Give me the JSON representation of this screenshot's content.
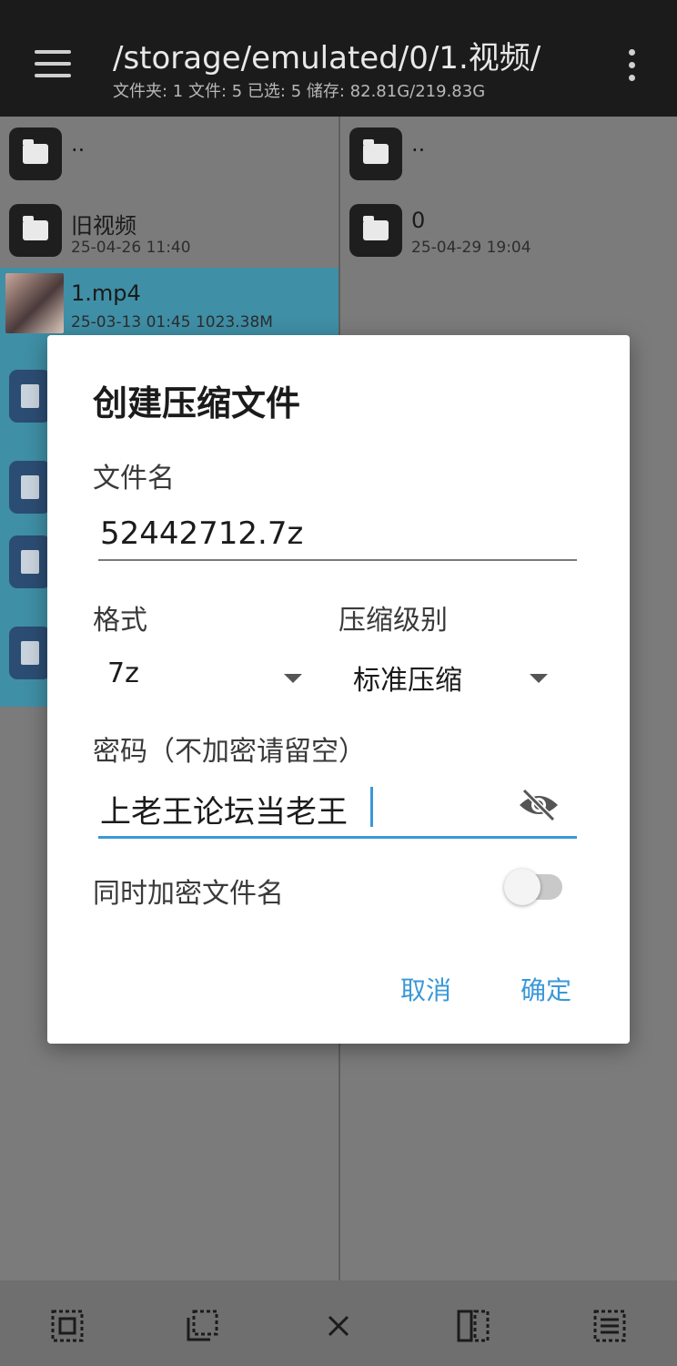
{
  "header": {
    "path": "/storage/emulated/0/1.视频/",
    "stats": "文件夹: 1  文件: 5  已选: 5  储存: 82.81G/219.83G"
  },
  "left_pane": {
    "items": [
      {
        "name": "..",
        "meta": ""
      },
      {
        "name": "旧视频",
        "meta": "25-04-26 11:40"
      },
      {
        "name": "1.mp4",
        "meta": "25-03-13 01:45  1023.38M"
      }
    ]
  },
  "right_pane": {
    "items": [
      {
        "name": "..",
        "meta": ""
      },
      {
        "name": "0",
        "meta": "25-04-29 19:04"
      }
    ]
  },
  "dialog": {
    "title": "创建压缩文件",
    "filename_label": "文件名",
    "filename_value": "52442712.7z",
    "format_label": "格式",
    "format_value": "7z",
    "level_label": "压缩级别",
    "level_value": "标准压缩",
    "password_label": "密码（不加密请留空）",
    "password_value": "上老王论坛当老王",
    "encrypt_names_label": "同时加密文件名",
    "encrypt_names_on": false,
    "cancel_label": "取消",
    "ok_label": "确定"
  },
  "colors": {
    "accent": "#3a98d8",
    "selected_row": "#3f8fa6"
  }
}
